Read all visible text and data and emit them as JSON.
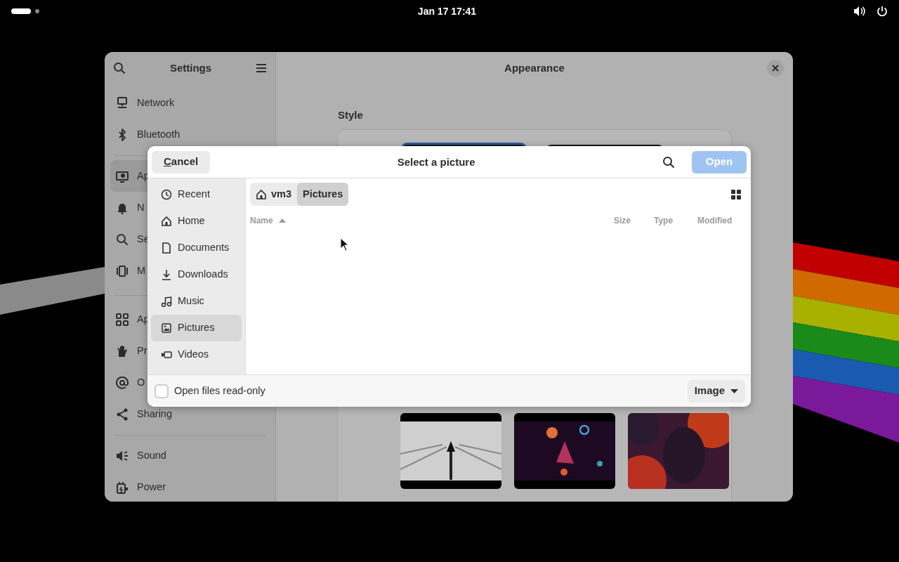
{
  "top_bar": {
    "clock": "Jan 17  17:41"
  },
  "settings": {
    "title": "Settings",
    "page_title": "Appearance",
    "section_title": "Style",
    "sidebar_groups": [
      {
        "items": [
          {
            "label": "Network",
            "selected": false
          },
          {
            "label": "Bluetooth",
            "selected": false
          }
        ]
      },
      {
        "items": [
          {
            "label": "Ap",
            "selected": true
          },
          {
            "label": "N",
            "selected": false
          },
          {
            "label": "Se",
            "selected": false
          },
          {
            "label": "M",
            "selected": false
          }
        ]
      },
      {
        "items": [
          {
            "label": "Ap",
            "selected": false
          },
          {
            "label": "Pr",
            "selected": false
          },
          {
            "label": "O",
            "selected": false
          },
          {
            "label": "Sharing",
            "selected": false
          }
        ]
      },
      {
        "items": [
          {
            "label": "Sound",
            "selected": false
          },
          {
            "label": "Power",
            "selected": false
          }
        ]
      }
    ]
  },
  "dialog": {
    "title": "Select a picture",
    "cancel": "Cancel",
    "open": {
      "label": "Open",
      "disabled": true
    },
    "places": [
      {
        "label": "Recent",
        "selected": false
      },
      {
        "label": "Home",
        "selected": false
      },
      {
        "label": "Documents",
        "selected": false
      },
      {
        "label": "Downloads",
        "selected": false
      },
      {
        "label": "Music",
        "selected": false
      },
      {
        "label": "Pictures",
        "selected": true
      },
      {
        "label": "Videos",
        "selected": false
      }
    ],
    "path": [
      {
        "label": "vm3",
        "kind": "home",
        "selected": false
      },
      {
        "label": "Pictures",
        "kind": "folder",
        "selected": true
      }
    ],
    "columns": [
      {
        "label": "Name",
        "sorted": true
      },
      {
        "label": "Size",
        "sorted": false
      },
      {
        "label": "Type",
        "sorted": false
      },
      {
        "label": "Modified",
        "sorted": false
      }
    ],
    "read_only": {
      "label": "Open files read-only",
      "checked": false
    },
    "filter": "Image"
  }
}
